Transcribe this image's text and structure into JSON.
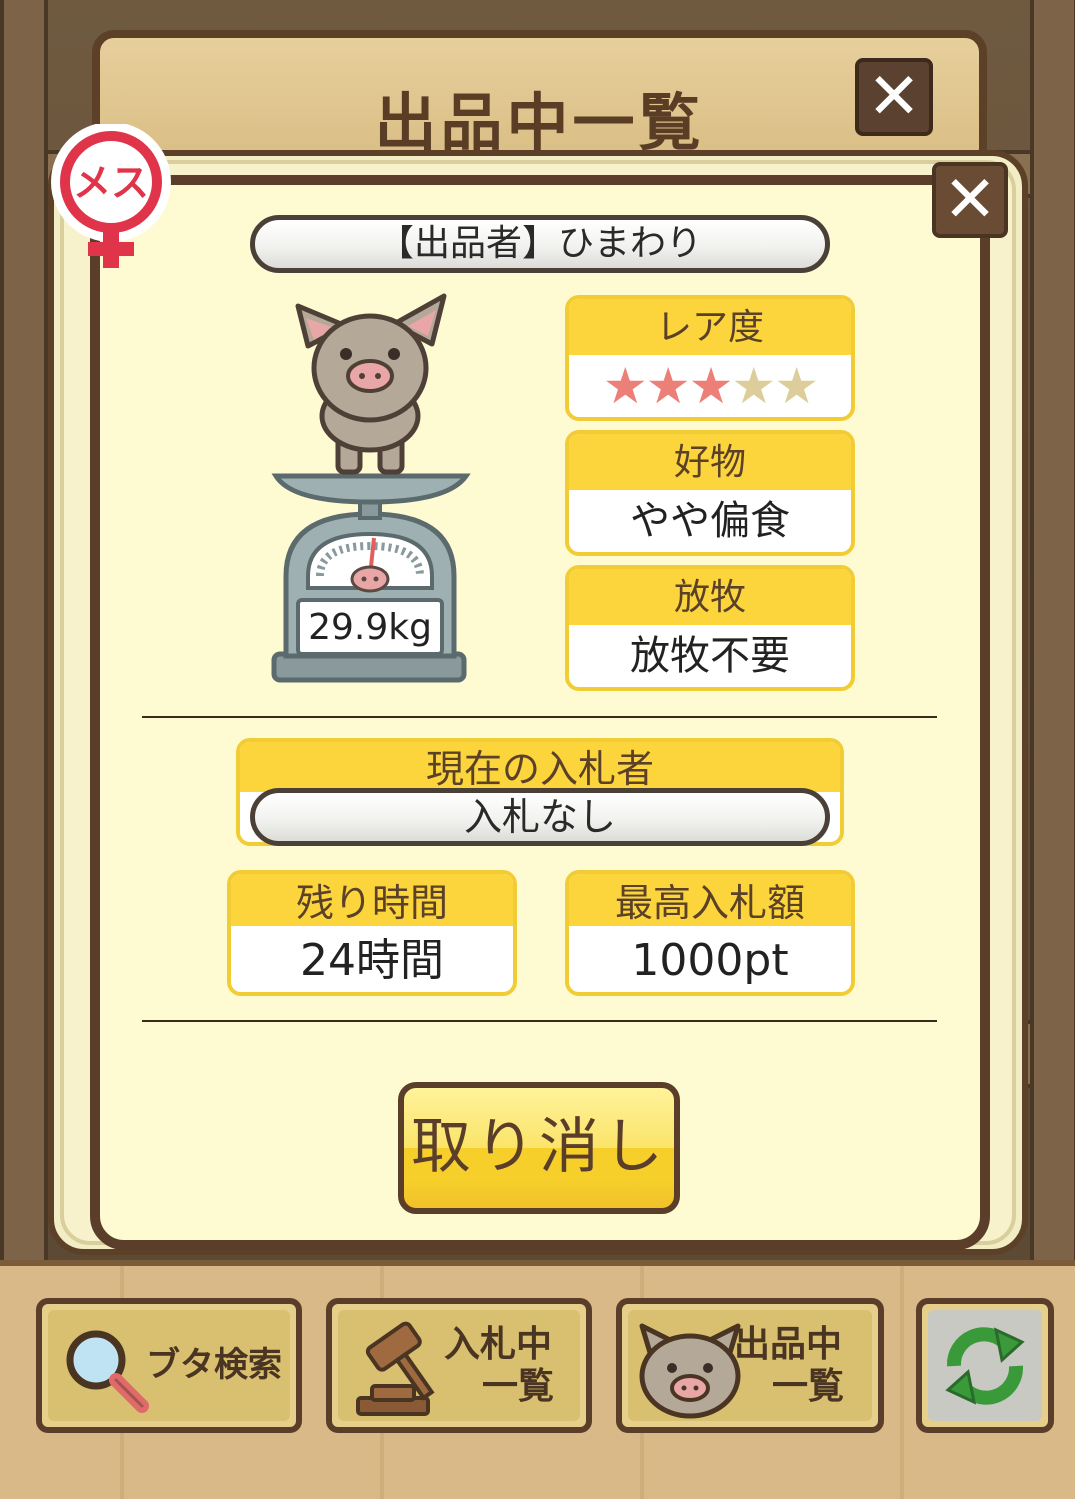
{
  "header": {
    "title": "出品中一覧",
    "close_label": "✕"
  },
  "detail": {
    "close_label": "✕",
    "gender": "メス",
    "seller": "【出品者】ひまわり",
    "weight": "29.9kg",
    "rarity": {
      "label": "レア度",
      "stars_filled": 3,
      "stars_total": 5,
      "filled_glyphs": "★★★",
      "empty_glyphs": "★★"
    },
    "favorite": {
      "label": "好物",
      "value": "やや偏食"
    },
    "grazing": {
      "label": "放牧",
      "value": "放牧不要"
    },
    "current_bidder": {
      "label": "現在の入札者",
      "value": "入札なし"
    },
    "time_left": {
      "label": "残り時間",
      "value": "24時間"
    },
    "max_bid": {
      "label": "最高入札額",
      "value": "1000pt"
    },
    "cancel_label": "取り消し"
  },
  "nav": {
    "search_label": "ブタ検索",
    "bidding_line1": "入札中",
    "bidding_line2": "一覧",
    "listed_line1": "出品中",
    "listed_line2": "一覧"
  },
  "colors": {
    "panel_bg": "#fefbd3",
    "card_header": "#fcd53c",
    "border_brown": "#5a3e29",
    "star_on": "#ec8078",
    "star_off": "#dccd9a",
    "female_red": "#e0344a"
  }
}
